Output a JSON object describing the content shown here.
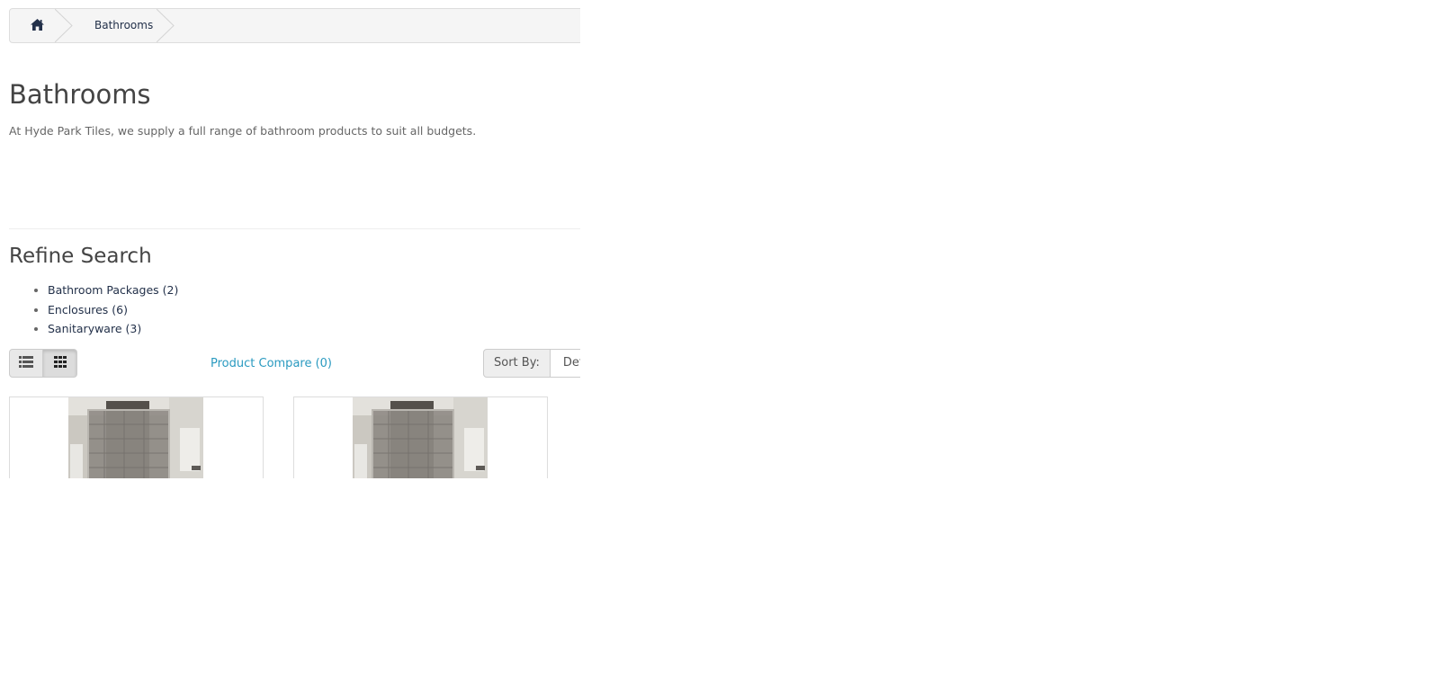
{
  "breadcrumb": {
    "home_icon": "home-icon",
    "items": [
      {
        "label": "Bathrooms"
      }
    ]
  },
  "category": {
    "title": "Bathrooms",
    "description": "At Hyde Park Tiles, we supply a full range of bathroom products to suit all budgets."
  },
  "refine": {
    "title": "Refine Search",
    "items": [
      {
        "label": "Bathroom Packages (2)"
      },
      {
        "label": "Enclosures (6)"
      },
      {
        "label": "Sanitaryware (3)"
      }
    ]
  },
  "toolbar": {
    "list_view_icon": "list-view-icon",
    "grid_view_icon": "grid-view-icon",
    "compare_label": "Product Compare (0)",
    "sort_label": "Sort By:",
    "sort_value": "Default"
  },
  "colors": {
    "link": "#2a9ac0",
    "nav_text": "#23314a",
    "heading": "#444444"
  },
  "products": [
    {
      "image": "shower-enclosure-image"
    },
    {
      "image": "shower-enclosure-image"
    }
  ]
}
